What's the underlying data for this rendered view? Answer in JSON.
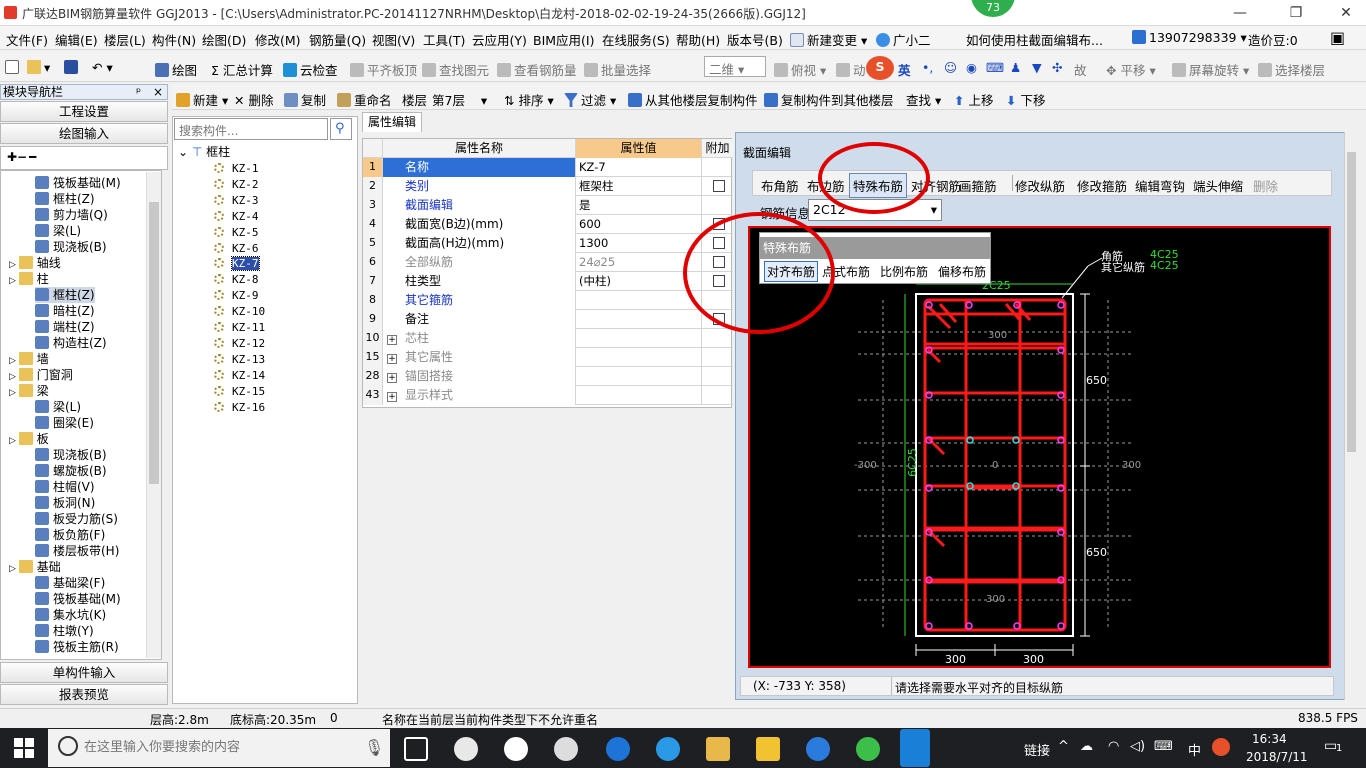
{
  "window": {
    "title": "广联达BIM钢筋算量软件 GGJ2013 - [C:\\Users\\Administrator.PC-20141127NRHM\\Desktop\\白龙村-2018-02-02-19-24-35(2666版).GGJ12]",
    "badge": "73"
  },
  "menu": [
    "文件(F)",
    "编辑(E)",
    "楼层(L)",
    "构件(N)",
    "绘图(D)",
    "修改(M)",
    "钢筋量(Q)",
    "视图(V)",
    "工具(T)",
    "云应用(Y)",
    "BIM应用(I)",
    "在线服务(S)",
    "帮助(H)",
    "版本号(B)",
    "新建变更",
    "广小二",
    "如何使用柱截面编辑布...",
    "13907298339",
    "造价豆:0"
  ],
  "toolbar1": [
    "绘图",
    "汇总计算",
    "云检查",
    "平齐板顶",
    "查找图元",
    "查看钢筋量",
    "批量选择",
    "二维",
    "俯视",
    "动",
    "英",
    "故",
    "平移",
    "屏幕旋转",
    "选择楼层"
  ],
  "toolbar2": [
    "新建",
    "删除",
    "复制",
    "重命名",
    "楼层",
    "第7层",
    "排序",
    "过滤",
    "从其他楼层复制构件",
    "复制构件到其他楼层",
    "查找",
    "上移",
    "下移"
  ],
  "nav": {
    "title": "模块导航栏",
    "pin": "ᵖ",
    "buttons": [
      "工程设置",
      "绘图输入"
    ],
    "bottom": [
      "单构件输入",
      "报表预览"
    ],
    "tree": [
      {
        "label": "筏板基础(M)",
        "level": 2
      },
      {
        "label": "框柱(Z)",
        "level": 2
      },
      {
        "label": "剪力墙(Q)",
        "level": 2
      },
      {
        "label": "梁(L)",
        "level": 2
      },
      {
        "label": "现浇板(B)",
        "level": 2
      },
      {
        "label": "轴线",
        "level": 1,
        "folder": true
      },
      {
        "label": "柱",
        "level": 1,
        "folder": true
      },
      {
        "label": "框柱(Z)",
        "level": 2,
        "selected": true
      },
      {
        "label": "暗柱(Z)",
        "level": 2
      },
      {
        "label": "端柱(Z)",
        "level": 2
      },
      {
        "label": "构造柱(Z)",
        "level": 2
      },
      {
        "label": "墙",
        "level": 1,
        "folder": true
      },
      {
        "label": "门窗洞",
        "level": 1,
        "folder": true
      },
      {
        "label": "梁",
        "level": 1,
        "folder": true
      },
      {
        "label": "梁(L)",
        "level": 2
      },
      {
        "label": "圈梁(E)",
        "level": 2
      },
      {
        "label": "板",
        "level": 1,
        "folder": true
      },
      {
        "label": "现浇板(B)",
        "level": 2
      },
      {
        "label": "螺旋板(B)",
        "level": 2
      },
      {
        "label": "柱帽(V)",
        "level": 2
      },
      {
        "label": "板洞(N)",
        "level": 2
      },
      {
        "label": "板受力筋(S)",
        "level": 2
      },
      {
        "label": "板负筋(F)",
        "level": 2
      },
      {
        "label": "楼层板带(H)",
        "level": 2
      },
      {
        "label": "基础",
        "level": 1,
        "folder": true
      },
      {
        "label": "基础梁(F)",
        "level": 2
      },
      {
        "label": "筏板基础(M)",
        "level": 2
      },
      {
        "label": "集水坑(K)",
        "level": 2
      },
      {
        "label": "柱墩(Y)",
        "level": 2
      },
      {
        "label": "筏板主筋(R)",
        "level": 2
      }
    ]
  },
  "components": {
    "search_placeholder": "搜索构件...",
    "root": "框柱",
    "items": [
      "KZ-1",
      "KZ-2",
      "KZ-3",
      "KZ-4",
      "KZ-5",
      "KZ-6",
      "KZ-7",
      "KZ-8",
      "KZ-9",
      "KZ-10",
      "KZ-11",
      "KZ-12",
      "KZ-13",
      "KZ-14",
      "KZ-15",
      "KZ-16"
    ],
    "selected": "KZ-7"
  },
  "props": {
    "tab": "属性编辑",
    "headers": [
      "属性名称",
      "属性值",
      "附加"
    ],
    "rows": [
      {
        "no": "1",
        "name": "名称",
        "value": "KZ-7",
        "cls": "blue",
        "cb": false
      },
      {
        "no": "2",
        "name": "类别",
        "value": "框架柱",
        "cls": "blue",
        "cb": true
      },
      {
        "no": "3",
        "name": "截面编辑",
        "value": "是",
        "cls": "blue",
        "cb": false
      },
      {
        "no": "4",
        "name": "截面宽(B边)(mm)",
        "value": "600",
        "cls": "",
        "cb": true
      },
      {
        "no": "5",
        "name": "截面高(H边)(mm)",
        "value": "1300",
        "cls": "",
        "cb": true
      },
      {
        "no": "6",
        "name": "全部纵筋",
        "value": "24⌀25",
        "cls": "gray",
        "cb": true
      },
      {
        "no": "7",
        "name": "柱类型",
        "value": "(中柱)",
        "cls": "",
        "cb": true
      },
      {
        "no": "8",
        "name": "其它箍筋",
        "value": "",
        "cls": "blue",
        "cb": false
      },
      {
        "no": "9",
        "name": "备注",
        "value": "",
        "cls": "",
        "cb": true
      },
      {
        "no": "10",
        "name": "芯柱",
        "value": "",
        "cls": "gray",
        "cb": false,
        "exp": true
      },
      {
        "no": "15",
        "name": "其它属性",
        "value": "",
        "cls": "gray",
        "cb": false,
        "exp": true
      },
      {
        "no": "28",
        "name": "锚固搭接",
        "value": "",
        "cls": "gray",
        "cb": false,
        "exp": true
      },
      {
        "no": "43",
        "name": "显示样式",
        "value": "",
        "cls": "gray",
        "cb": false,
        "exp": true
      }
    ]
  },
  "section": {
    "title": "截面编辑",
    "tools": [
      "布角筋",
      "布边筋",
      "特殊布筋",
      "对齐钢筋",
      "画箍筋",
      "修改纵筋",
      "修改箍筋",
      "编辑弯钩",
      "端头伸缩",
      "删除"
    ],
    "rebar_label": "钢筋信息",
    "rebar_value": "2C12",
    "popup": {
      "title": "特殊布筋",
      "items": [
        "对齐布筋",
        "点式布筋",
        "比例布筋",
        "偏移布筋"
      ]
    },
    "drawing": {
      "corner": "角筋",
      "other": "其它纵筋",
      "corner_val": "4C25",
      "other_val": "4C25",
      "top": "2C25",
      "side": "6C25",
      "d650a": "650",
      "d650b": "650",
      "b300a": "300",
      "b300b": "300",
      "g300t": "300",
      "g300b": "300",
      "gl": "-300",
      "gr": "300",
      "g0": "0"
    },
    "coords": "(X: -733 Y: 358)",
    "hint": "请选择需要水平对齐的目标纵筋"
  },
  "status": {
    "floor_h": "层高:2.8m",
    "base_h": "底标高:20.35m",
    "zero": "0",
    "msg": "名称在当前层当前构件类型下不允许重名",
    "fps": "838.5 FPS"
  },
  "taskbar": {
    "search": "在这里输入你要搜索的内容",
    "link": "链接",
    "ime": "中",
    "time": "16:34",
    "date": "2018/7/11",
    "notif": "1"
  }
}
